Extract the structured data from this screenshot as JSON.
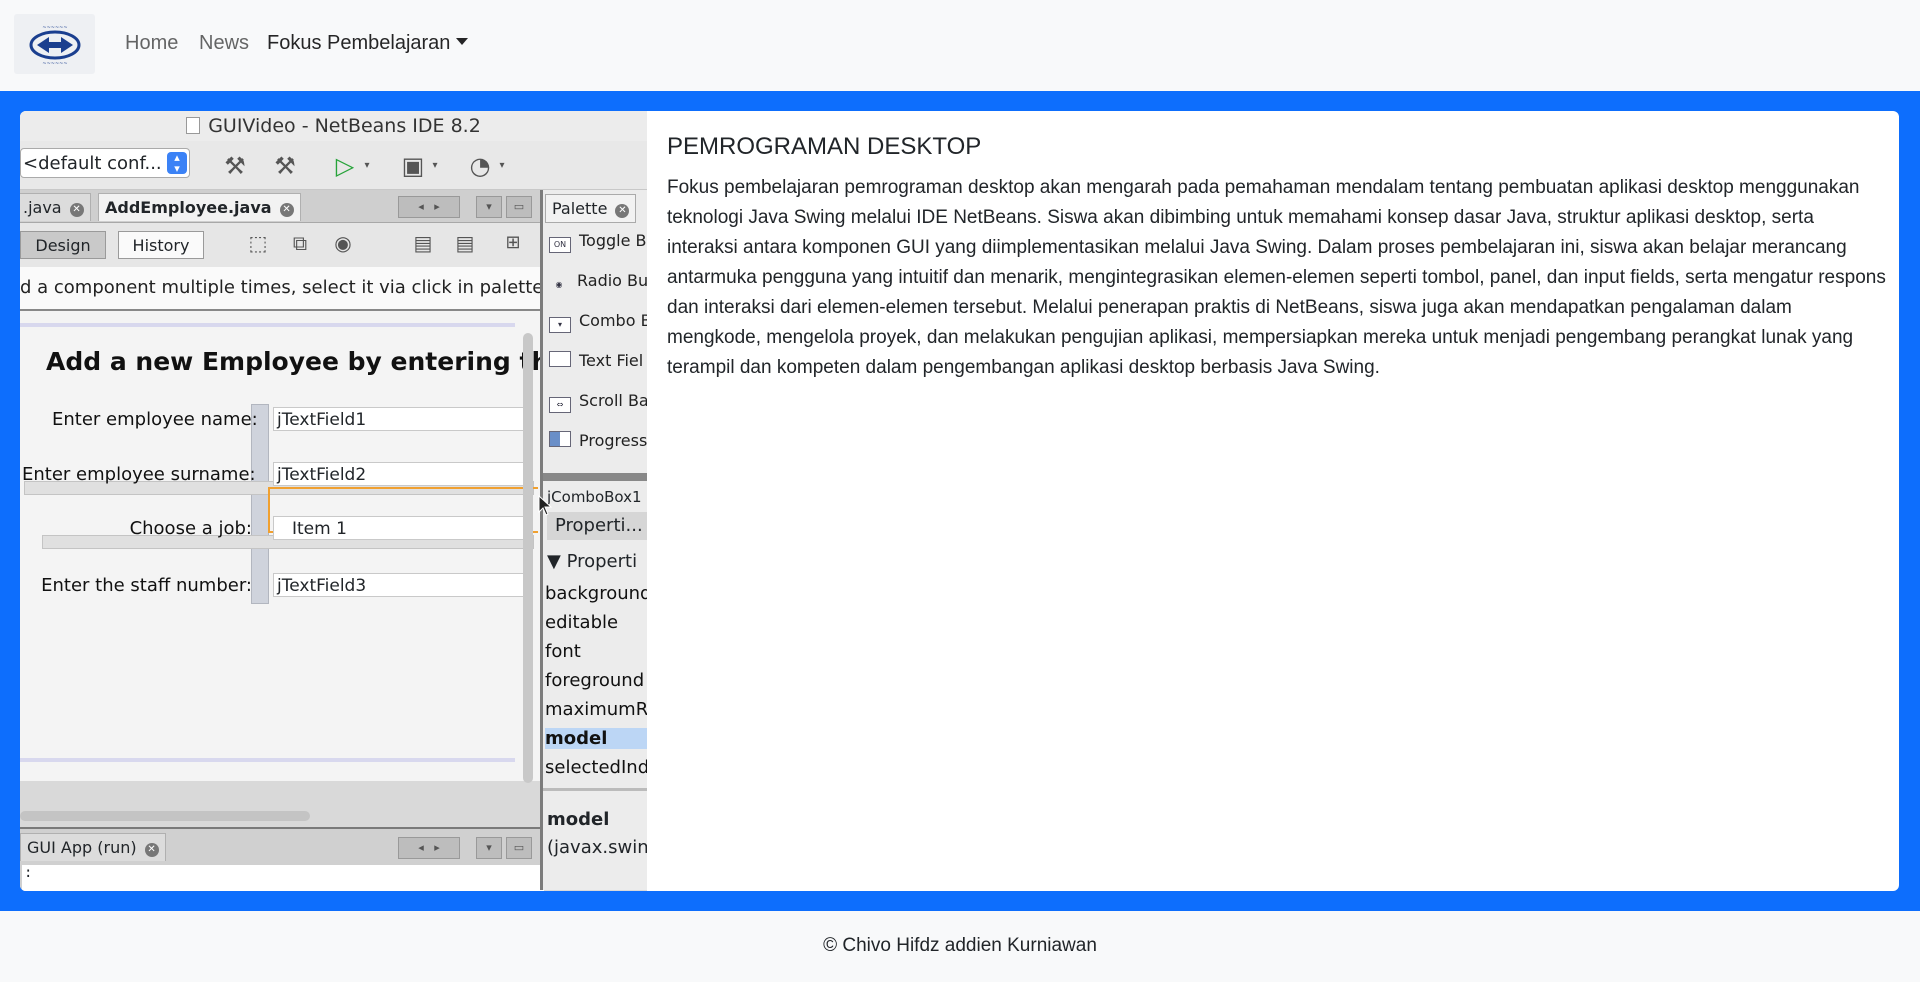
{
  "navbar": {
    "logo_alt": "logo",
    "links": [
      "Home",
      "News",
      "Fokus Pembelajaran"
    ]
  },
  "ide": {
    "window_title": "GUIVideo - NetBeans IDE 8.2",
    "config": "<default conf...",
    "tabs": [
      ".java",
      "AddEmployee.java"
    ],
    "design_tabs": [
      "Design",
      "History"
    ],
    "hint": "d a component multiple times, select it via click in palette",
    "form_title": "Add a new Employee by entering th",
    "labels": [
      "Enter employee name:",
      "Enter employee surname:",
      "Choose a job:",
      "Enter the staff number:"
    ],
    "fields": [
      "jTextField1",
      "jTextField2",
      "Item 1",
      "jTextField3"
    ],
    "run_tab": "GUI App (run)",
    "run_output": ":",
    "palette": {
      "tab": "Palette",
      "items": [
        "Toggle B",
        "Radio But",
        "Combo B",
        "Text Fiel",
        "Scroll Bar",
        "Progress"
      ],
      "icon_labels": [
        "ON",
        "◉",
        "▾",
        "",
        "⇔",
        ""
      ]
    },
    "properties": {
      "component": "jComboBox1",
      "tab": "Properti...",
      "section": "Properti",
      "rows": [
        "background",
        "editable",
        "font",
        "foreground",
        "maximumR",
        "model",
        "selectedInd"
      ],
      "selected": "model",
      "desc_title": "model",
      "desc_text": "(javax.swin"
    }
  },
  "content": {
    "heading": "PEMROGRAMAN DESKTOP",
    "paragraph": "Fokus pembelajaran pemrograman desktop akan mengarah pada pemahaman mendalam tentang pembuatan aplikasi desktop menggunakan teknologi Java Swing melalui IDE NetBeans. Siswa akan dibimbing untuk memahami konsep dasar Java, struktur aplikasi desktop, serta interaksi antara komponen GUI yang diimplementasikan melalui Java Swing. Dalam proses pembelajaran ini, siswa akan belajar merancang antarmuka pengguna yang intuitif dan menarik, mengintegrasikan elemen-elemen seperti tombol, panel, dan input fields, serta mengatur respons dan interaksi dari elemen-elemen tersebut. Melalui penerapan praktis di NetBeans, siswa juga akan mendapatkan pengalaman dalam mengkode, mengelola proyek, dan melakukan pengujian aplikasi, mempersiapkan mereka untuk menjadi pengembang perangkat lunak yang terampil dan kompeten dalam pengembangan aplikasi desktop berbasis Java Swing."
  },
  "footer": {
    "text": "© Chivo Hifdz addien Kurniawan"
  },
  "colors": {
    "primary": "#0d6efd",
    "navbar_bg": "#f8f9fa",
    "card_bg": "#ffffff"
  }
}
